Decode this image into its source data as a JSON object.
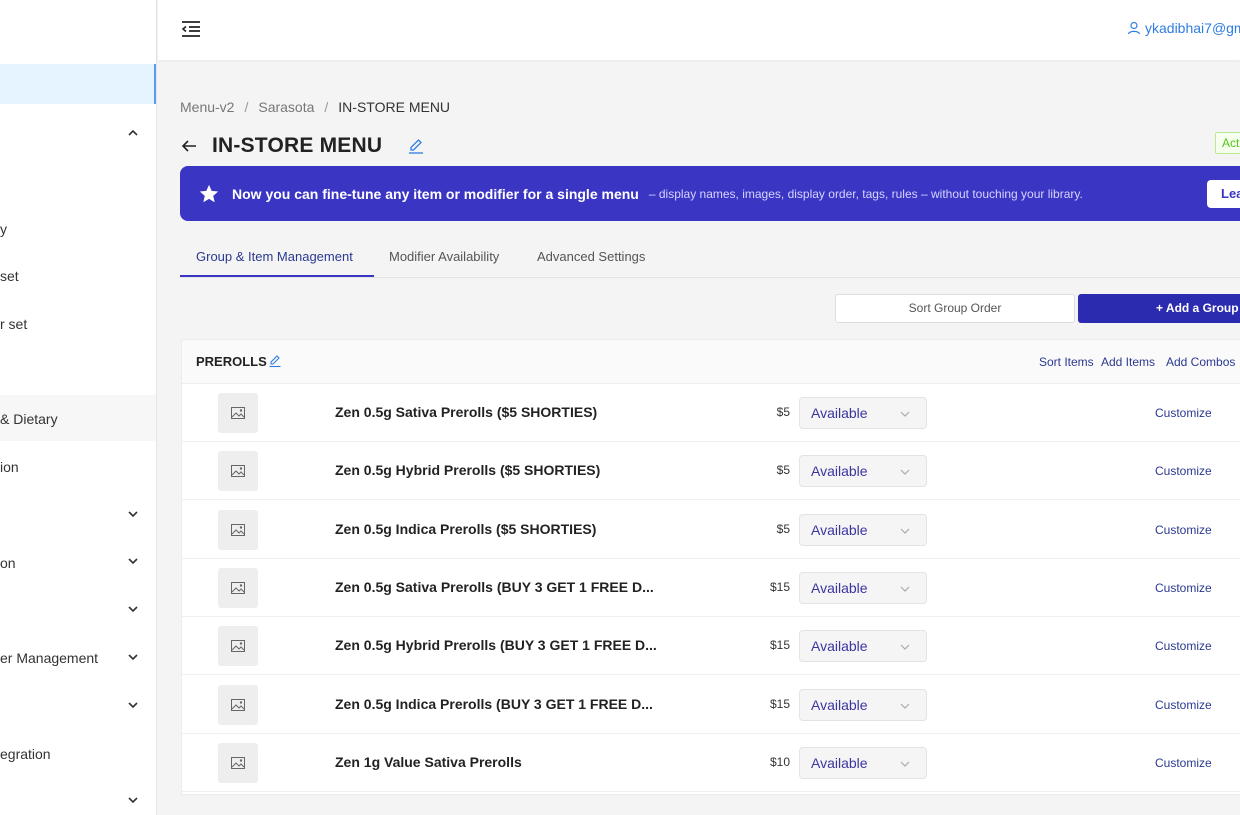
{
  "sidebar": {
    "items": [
      {
        "label": "y"
      },
      {
        "label": "set"
      },
      {
        "label": "r set"
      },
      {
        "label": "& Dietary"
      },
      {
        "label": "ion"
      },
      {
        "label": "on"
      },
      {
        "label": "er Management"
      },
      {
        "label": "egration"
      }
    ]
  },
  "header": {
    "user_email": "ykadibhai7@gm"
  },
  "breadcrumb": {
    "items": [
      "Menu-v2",
      "Sarasota",
      "IN-STORE MENU"
    ],
    "separator": "/"
  },
  "page": {
    "title": "IN-STORE MENU",
    "status_badge": "Act"
  },
  "banner": {
    "headline": "Now you can fine-tune any item or modifier for a single menu",
    "detail": "– display names, images, display order, tags, rules – without touching your library.",
    "button_label": "Lea"
  },
  "tabs": [
    {
      "label": "Group & Item Management",
      "active": true
    },
    {
      "label": "Modifier Availability",
      "active": false
    },
    {
      "label": "Advanced Settings",
      "active": false
    }
  ],
  "actions": {
    "sort_group": "Sort Group Order",
    "add_group": "+ Add a Group"
  },
  "group": {
    "name": "PREROLLS",
    "links": {
      "sort_items": "Sort Items",
      "add_items": "Add Items",
      "add_combos": "Add Combos"
    },
    "items": [
      {
        "name": "Zen 0.5g Sativa Prerolls ($5 SHORTIES)",
        "price": "$5",
        "status": "Available",
        "action": "Customize"
      },
      {
        "name": "Zen 0.5g Hybrid Prerolls ($5 SHORTIES)",
        "price": "$5",
        "status": "Available",
        "action": "Customize"
      },
      {
        "name": "Zen 0.5g Indica Prerolls ($5 SHORTIES)",
        "price": "$5",
        "status": "Available",
        "action": "Customize"
      },
      {
        "name": "Zen 0.5g Sativa Prerolls (BUY 3 GET 1 FREE D...",
        "price": "$15",
        "status": "Available",
        "action": "Customize"
      },
      {
        "name": "Zen 0.5g Hybrid Prerolls (BUY 3 GET 1 FREE D...",
        "price": "$15",
        "status": "Available",
        "action": "Customize"
      },
      {
        "name": "Zen 0.5g Indica Prerolls (BUY 3 GET 1 FREE D...",
        "price": "$15",
        "status": "Available",
        "action": "Customize"
      },
      {
        "name": "Zen 1g Value Sativa Prerolls",
        "price": "$10",
        "status": "Available",
        "action": "Customize"
      }
    ]
  },
  "colors": {
    "primary": "#3b35c3",
    "link": "#2b3990",
    "user_link": "#2f7de1",
    "sidebar_active": "#e6f4ff",
    "badge_green": "#52c41a"
  },
  "icons": {
    "menu_toggle": "menu-fold-icon",
    "user": "user-icon",
    "back": "arrow-left-icon",
    "edit": "edit-pencil-icon",
    "star": "star-icon",
    "thumb": "image-placeholder-icon",
    "chevron": "chevron-down-icon"
  }
}
